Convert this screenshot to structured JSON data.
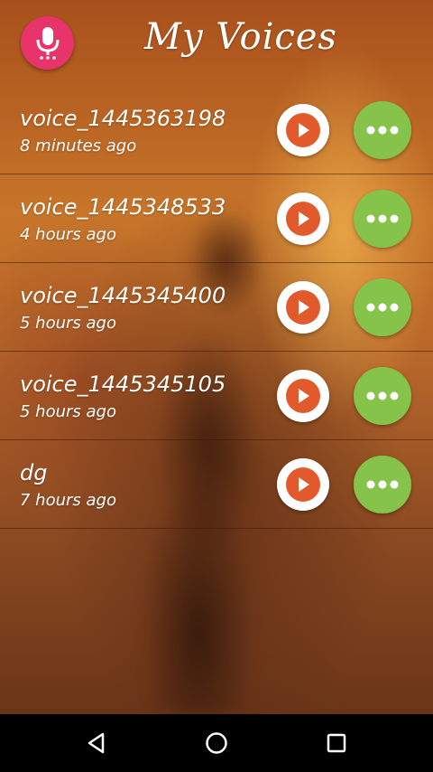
{
  "header": {
    "title": "My Voices",
    "mic_icon": "microphone-icon",
    "accent_color": "#e8336b"
  },
  "recordings": [
    {
      "name": "voice_1445363198",
      "time": "8 minutes ago"
    },
    {
      "name": "voice_1445348533",
      "time": "4 hours ago"
    },
    {
      "name": "voice_1445345400",
      "time": "5 hours ago"
    },
    {
      "name": "voice_1445345105",
      "time": "5 hours ago"
    },
    {
      "name": "dg",
      "time": "7 hours ago"
    }
  ],
  "row_actions": {
    "play_icon": "play-icon",
    "play_color": "#e25a2b",
    "more_icon": "more-horizontal-icon",
    "more_color": "#86c34a"
  },
  "navbar": {
    "back_icon": "back-triangle-icon",
    "home_icon": "home-circle-icon",
    "recents_icon": "recents-square-icon"
  }
}
